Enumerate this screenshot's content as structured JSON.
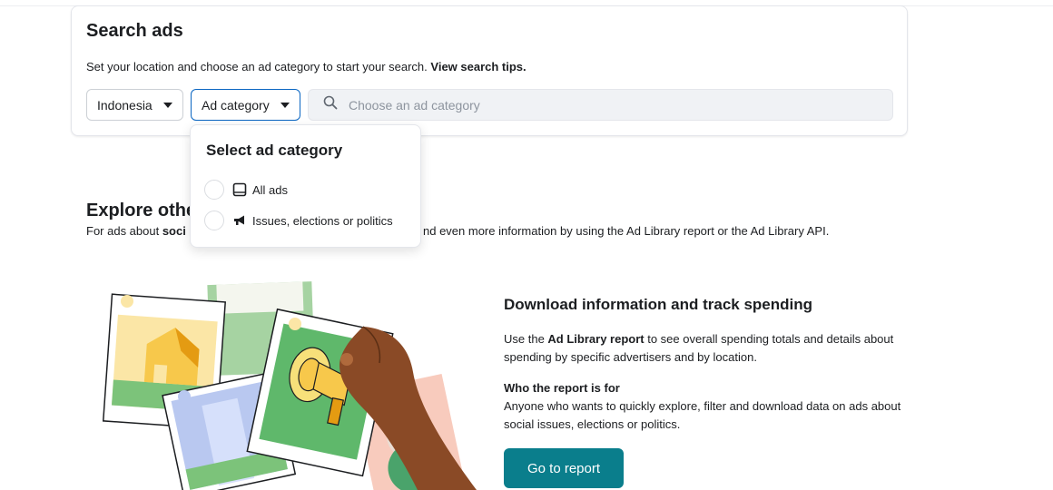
{
  "search": {
    "title": "Search ads",
    "subtitle_prefix": "Set your location and choose an ad category to start your search. ",
    "subtitle_link": "View search tips.",
    "country_selected": "Indonesia",
    "category_selected": "Ad category",
    "placeholder": "Choose an ad category",
    "icons": {
      "search": "search-icon",
      "caret": "caret-down-icon"
    }
  },
  "category_menu": {
    "title": "Select ad category",
    "options": [
      {
        "label": "All ads",
        "icon": "tablet-icon"
      },
      {
        "label": "Issues, elections or politics",
        "icon": "megaphone-icon"
      }
    ]
  },
  "explore": {
    "title": "Explore other",
    "text_prefix": "For ads about ",
    "text_bold": "soci",
    "text_suffix": "nd even more information by using the Ad Library report or the Ad Library API."
  },
  "report": {
    "title": "Download information and track spending",
    "para_prefix": "Use the ",
    "para_bold": "Ad Library report",
    "para_suffix": " to see overall spending totals and details about spending by specific advertisers and by location.",
    "who_heading": "Who the report is for",
    "who_text": "Anyone who wants to quickly explore, filter and download data on ads about social issues, elections or politics.",
    "button_label": "Go to report"
  },
  "colors": {
    "accent": "#0a66c2",
    "button": "#0a7e8c",
    "text": "#1c1e21",
    "placeholder": "#8d949e"
  }
}
